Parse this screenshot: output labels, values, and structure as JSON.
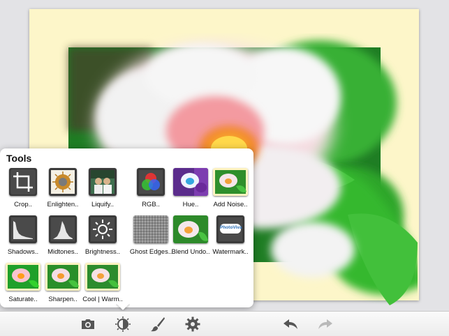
{
  "tools_panel": {
    "title": "Tools",
    "items": [
      {
        "label": "Crop..",
        "icon": "crop-icon"
      },
      {
        "label": "Enlighten..",
        "icon": "enlighten-icon"
      },
      {
        "label": "Liquify..",
        "icon": "liquify-icon"
      },
      {
        "label": "RGB..",
        "icon": "rgb-icon"
      },
      {
        "label": "Hue..",
        "icon": "hue-icon"
      },
      {
        "label": "Add Noise..",
        "icon": "add-noise-icon"
      },
      {
        "label": "Shadows..",
        "icon": "shadows-histogram-icon"
      },
      {
        "label": "Midtones..",
        "icon": "midtones-histogram-icon"
      },
      {
        "label": "Brightness..",
        "icon": "brightness-icon"
      },
      {
        "label": "Ghost Edges..",
        "icon": "ghost-edges-icon"
      },
      {
        "label": "Blend Undo..",
        "icon": "blend-undo-icon"
      },
      {
        "label": "Watermark..",
        "icon": "watermark-icon"
      },
      {
        "label": "Saturate..",
        "icon": "saturate-icon"
      },
      {
        "label": "Sharpen..",
        "icon": "sharpen-icon"
      },
      {
        "label": "Cool | Warm..",
        "icon": "cool-warm-icon"
      }
    ],
    "watermark_thumb_text": "PhotoViva"
  },
  "toolbar": {
    "icons": [
      "camera-icon",
      "adjust-icon",
      "brush-icon",
      "gear-icon",
      "undo-icon",
      "redo-icon"
    ]
  },
  "colors": {
    "canvas_background": "#fdf6c9",
    "leaf_green": "#2fb52a",
    "toolbar_icon": "#555555"
  }
}
